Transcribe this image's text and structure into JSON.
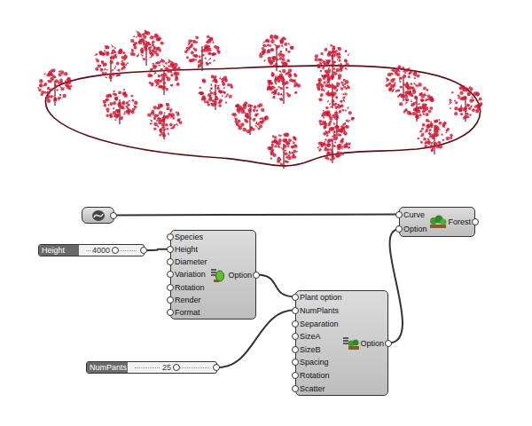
{
  "canvas": {
    "sliders": [
      {
        "label": "Height",
        "value": "4000",
        "level": 0.58
      },
      {
        "label": "NumPants",
        "value": "25",
        "level": 0.56
      }
    ],
    "plant_component": {
      "inputs": [
        "Species",
        "Height",
        "Diameter",
        "Variation",
        "Rotation",
        "Render",
        "Format"
      ],
      "outputs": [
        "Option"
      ]
    },
    "option_component": {
      "inputs": [
        "Plant option",
        "NumPlants",
        "Separation",
        "SizeA",
        "SizeB",
        "Spacing",
        "Rotation",
        "Scatter"
      ],
      "outputs": [
        "Option"
      ]
    },
    "forest_component": {
      "inputs": [
        "Curve",
        "Option"
      ],
      "outputs": [
        "Forest"
      ]
    }
  }
}
